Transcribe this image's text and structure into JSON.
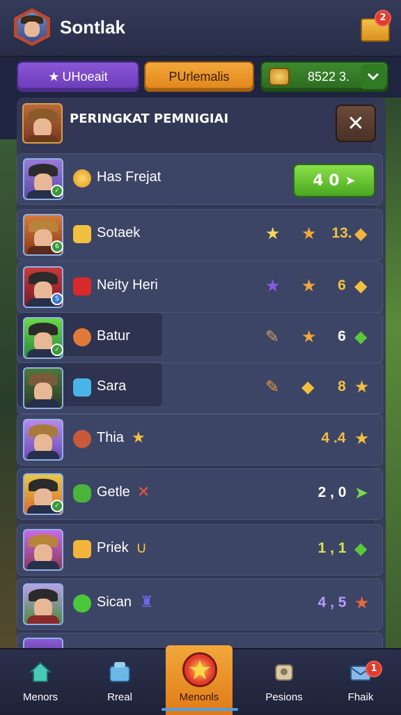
{
  "header": {
    "title": "Sontlak",
    "notification_count": "2"
  },
  "top_buttons": [
    {
      "label": "UHoeait"
    },
    {
      "label": "PUrlemalis"
    },
    {
      "label": "8522 3."
    }
  ],
  "panel": {
    "title": "PERINGKAT PEMNIGIAI",
    "close_glyph": "✕"
  },
  "rows": [
    {
      "name": "Has Frejat",
      "score": "4 0",
      "score_arrow": "➤"
    },
    {
      "name": "Sotaek",
      "score": "13."
    },
    {
      "name": "Neity Heri",
      "score": "6"
    },
    {
      "name": "Batur",
      "score": "6"
    },
    {
      "name": "Sara",
      "score": "8"
    },
    {
      "name": "Thia",
      "score": "4 .4"
    },
    {
      "name": "Getle",
      "score": "2 , 0"
    },
    {
      "name": "Priek",
      "score": "1 , 1"
    },
    {
      "name": "Sican",
      "score": "4 , 5"
    }
  ],
  "nav": [
    {
      "label": "Menors"
    },
    {
      "label": "Rreal"
    },
    {
      "label": "Menonls"
    },
    {
      "label": "Pesions"
    },
    {
      "label": "Fhaik",
      "badge": "1"
    }
  ],
  "colors": {
    "accent_orange": "#e0851a",
    "accent_purple": "#6a3bb8",
    "accent_green": "#4aa820",
    "score_gold": "#f2c040",
    "panel": "#343a58"
  },
  "icons": {
    "top_left": "avatar-icon",
    "top_right": "treasure-chest-icon",
    "pill_1": "star-icon",
    "pill_3": "coin-icon",
    "pill_3_dropdown": "chevron-down-icon"
  }
}
